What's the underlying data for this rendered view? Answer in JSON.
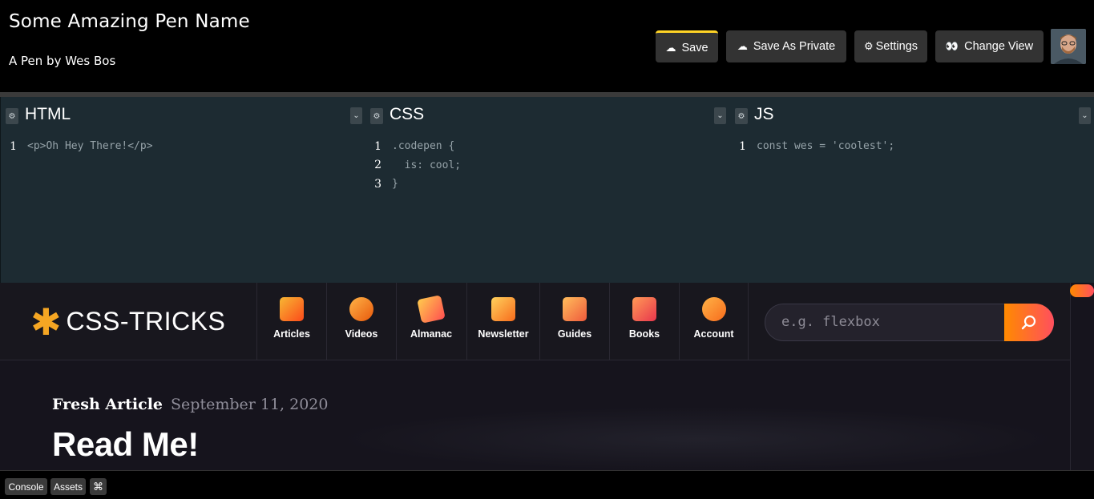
{
  "header": {
    "pen_title": "Some Amazing Pen Name",
    "author_line": "A Pen by Wes Bos",
    "buttons": {
      "save": "Save",
      "save_private": "Save As Private",
      "settings": "Settings",
      "change_view": "Change View"
    },
    "icons": {
      "save": "cloud-icon",
      "save_private": "cloud-icon",
      "settings": "gear-icon",
      "change_view": "eyes-icon"
    },
    "accent_color": "#ffd426"
  },
  "editors": [
    {
      "title": "HTML",
      "lines": [
        {
          "num": "1",
          "code": "<p>Oh Hey There!</p>"
        }
      ]
    },
    {
      "title": "CSS",
      "lines": [
        {
          "num": "1",
          "code": ".codepen {"
        },
        {
          "num": "2",
          "code": "  is: cool;"
        },
        {
          "num": "3",
          "code": "}"
        }
      ]
    },
    {
      "title": "JS",
      "lines": [
        {
          "num": "1",
          "code": "const wes = 'coolest';"
        }
      ]
    }
  ],
  "preview": {
    "logo_text": "CSS-TRICKS",
    "nav": [
      {
        "label": "Articles",
        "icon": "articles-icon"
      },
      {
        "label": "Videos",
        "icon": "videos-icon"
      },
      {
        "label": "Almanac",
        "icon": "almanac-icon"
      },
      {
        "label": "Newsletter",
        "icon": "newsletter-icon"
      },
      {
        "label": "Guides",
        "icon": "guides-icon"
      },
      {
        "label": "Books",
        "icon": "books-icon"
      },
      {
        "label": "Account",
        "icon": "account-icon"
      }
    ],
    "search_placeholder": "e.g. flexbox",
    "fresh_label": "Fresh Article",
    "fresh_date": "September 11, 2020",
    "headline": "Read Me!",
    "brand_color": "#f5a623"
  },
  "footer": {
    "console": "Console",
    "assets": "Assets",
    "shortcut": "⌘"
  }
}
